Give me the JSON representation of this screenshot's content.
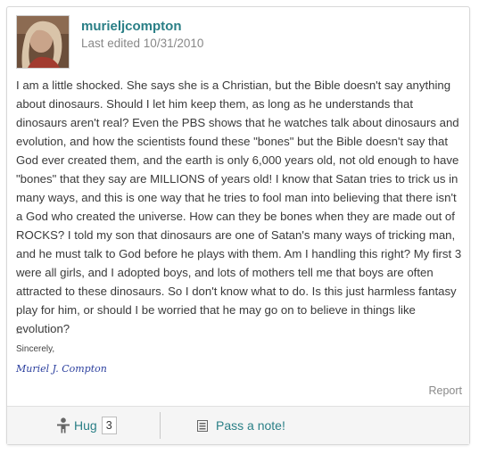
{
  "post": {
    "username": "murieljcompton",
    "edited": "Last edited 10/31/2010",
    "body": "I am a little shocked. She says she is a Christian, but the Bible doesn't say anything about dinosaurs. Should I let him keep them, as long as he understands that dinosaurs aren't real? Even the PBS shows that he watches talk about dinosaurs and evolution, and how the scientists found these \"bones\" but the Bible doesn't say that God ever created them, and the earth is only 6,000 years old, not old enough to have \"bones\" that they say are MILLIONS of years old! I know that Satan tries to trick us in many ways, and this is one way that he tries to fool man into believing that there isn't a God who created the universe. How can they be bones when they are made out of ROCKS? I told my son that dinosaurs are one of Satan's many ways of tricking man, and he must talk to God before he plays with them. Am I handling this right? My first 3 were all girls, and I adopted boys, and lots of mothers tell me that boys are often attracted to these dinosaurs. So I don't know what to do. Is this just harmless fantasy play for him, or should I be worried that he may go on to believe in things like evolution?"
  },
  "signature": {
    "dash": "--",
    "sincerely": "Sincerely,",
    "name": "Muriel J. Compton"
  },
  "actions": {
    "report": "Report",
    "hug_label": "Hug",
    "hug_count": "3",
    "note_label": "Pass a note!"
  },
  "icons": {
    "hug": "person-hug-icon",
    "note": "note-list-icon"
  },
  "colors": {
    "link": "#2a7f86",
    "signature": "#2b3f9e",
    "muted": "#888888"
  }
}
